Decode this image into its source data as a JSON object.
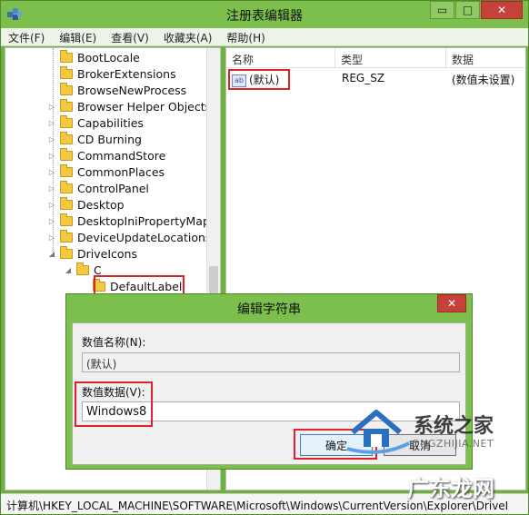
{
  "window": {
    "title": "注册表编辑器",
    "buttons": {
      "minimize": "▭",
      "maximize": "□",
      "close": "✕"
    }
  },
  "menu": [
    "文件(F)",
    "编辑(E)",
    "查看(V)",
    "收藏夹(A)",
    "帮助(H)"
  ],
  "tree": {
    "items": [
      {
        "label": "BootLocale",
        "expandable": false
      },
      {
        "label": "BrokerExtensions",
        "expandable": false
      },
      {
        "label": "BrowseNewProcess",
        "expandable": false
      },
      {
        "label": "Browser Helper Objects",
        "expandable": true
      },
      {
        "label": "Capabilities",
        "expandable": true
      },
      {
        "label": "CD Burning",
        "expandable": true
      },
      {
        "label": "CommandStore",
        "expandable": true
      },
      {
        "label": "CommonPlaces",
        "expandable": true
      },
      {
        "label": "ControlPanel",
        "expandable": true
      },
      {
        "label": "Desktop",
        "expandable": true
      },
      {
        "label": "DesktopIniPropertyMap",
        "expandable": true
      },
      {
        "label": "DeviceUpdateLocations",
        "expandable": true
      },
      {
        "label": "DriveIcons",
        "expandable": "open"
      },
      {
        "label": "C",
        "expandable": "open"
      },
      {
        "label": "DefaultLabel",
        "expandable": false
      }
    ]
  },
  "list": {
    "columns": [
      "名称",
      "类型",
      "数据"
    ],
    "rows": [
      {
        "name": "(默认)",
        "type": "REG_SZ",
        "data": "(数值未设置)",
        "icon": "ab"
      }
    ]
  },
  "status": "计算机\\HKEY_LOCAL_MACHINE\\SOFTWARE\\Microsoft\\Windows\\CurrentVersion\\Explorer\\DriveI",
  "dialog": {
    "title": "编辑字符串",
    "close": "✕",
    "name_label": "数值名称(N):",
    "name_value": "(默认)",
    "data_label": "数值数据(V):",
    "data_value": "Windows8",
    "ok_label": "确定",
    "cancel_label": "取消"
  },
  "watermark": {
    "brand": "系统之家",
    "url": "ONGZHIJIA.NET",
    "bottom": "广东龙网"
  },
  "colors": {
    "highlight": "#e0202a",
    "titlebar": "#7cbf4c",
    "close": "#c7403a"
  }
}
